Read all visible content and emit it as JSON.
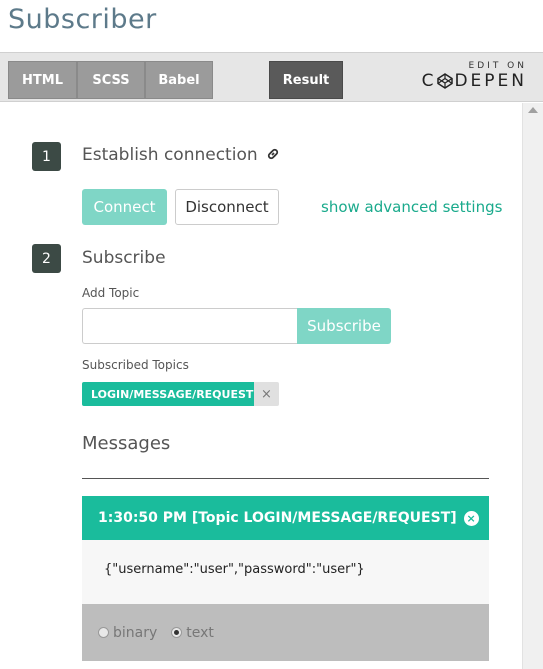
{
  "page": {
    "title": "Subscriber"
  },
  "codepen": {
    "tabs": [
      {
        "label": "HTML"
      },
      {
        "label": "SCSS"
      },
      {
        "label": "Babel"
      }
    ],
    "result_label": "Result",
    "edit_on": "EDIT ON",
    "brand_left": "C",
    "brand_right": "DEPEN"
  },
  "step1": {
    "number": "1",
    "title": "Establish connection",
    "link_icon": "link-icon",
    "connect_label": "Connect",
    "disconnect_label": "Disconnect",
    "advanced_link": "show advanced settings"
  },
  "step2": {
    "number": "2",
    "title": "Subscribe",
    "add_topic_label": "Add Topic",
    "topic_input_value": "",
    "subscribe_label": "Subscribe",
    "subscribed_topics_label": "Subscribed Topics",
    "topics": [
      {
        "name": "LOGIN/MESSAGE/REQUEST"
      }
    ],
    "chip_remove": "×"
  },
  "messages": {
    "title": "Messages",
    "items": [
      {
        "header": "1:30:50 PM [Topic LOGIN/MESSAGE/REQUEST]",
        "close_glyph": "×",
        "body": "{\"username\":\"user\",\"password\":\"user\"}",
        "format_options": [
          {
            "label": "binary",
            "checked": false
          },
          {
            "label": "text",
            "checked": true
          }
        ]
      }
    ]
  },
  "colors": {
    "accent": "#1abc9c",
    "accent_light": "#7fd6c6",
    "badge": "#3c4a45",
    "title": "#5d7a8a"
  }
}
